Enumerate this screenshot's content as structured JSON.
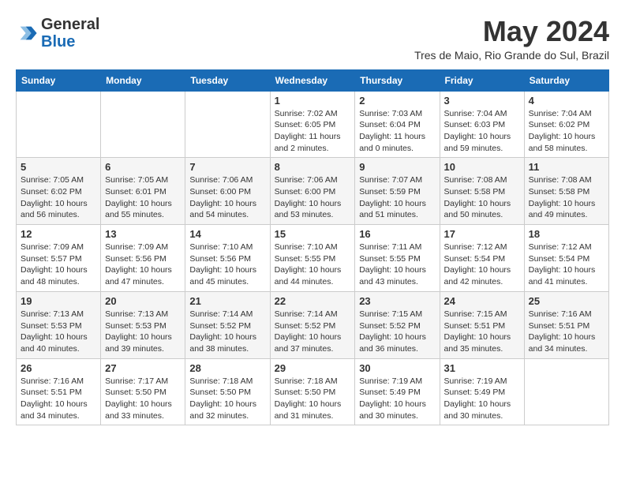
{
  "header": {
    "logo_general": "General",
    "logo_blue": "Blue",
    "month_title": "May 2024",
    "location": "Tres de Maio, Rio Grande do Sul, Brazil"
  },
  "calendar": {
    "days_of_week": [
      "Sunday",
      "Monday",
      "Tuesday",
      "Wednesday",
      "Thursday",
      "Friday",
      "Saturday"
    ],
    "weeks": [
      [
        {
          "day": "",
          "content": ""
        },
        {
          "day": "",
          "content": ""
        },
        {
          "day": "",
          "content": ""
        },
        {
          "day": "1",
          "content": "Sunrise: 7:02 AM\nSunset: 6:05 PM\nDaylight: 11 hours\nand 2 minutes."
        },
        {
          "day": "2",
          "content": "Sunrise: 7:03 AM\nSunset: 6:04 PM\nDaylight: 11 hours\nand 0 minutes."
        },
        {
          "day": "3",
          "content": "Sunrise: 7:04 AM\nSunset: 6:03 PM\nDaylight: 10 hours\nand 59 minutes."
        },
        {
          "day": "4",
          "content": "Sunrise: 7:04 AM\nSunset: 6:02 PM\nDaylight: 10 hours\nand 58 minutes."
        }
      ],
      [
        {
          "day": "5",
          "content": "Sunrise: 7:05 AM\nSunset: 6:02 PM\nDaylight: 10 hours\nand 56 minutes."
        },
        {
          "day": "6",
          "content": "Sunrise: 7:05 AM\nSunset: 6:01 PM\nDaylight: 10 hours\nand 55 minutes."
        },
        {
          "day": "7",
          "content": "Sunrise: 7:06 AM\nSunset: 6:00 PM\nDaylight: 10 hours\nand 54 minutes."
        },
        {
          "day": "8",
          "content": "Sunrise: 7:06 AM\nSunset: 6:00 PM\nDaylight: 10 hours\nand 53 minutes."
        },
        {
          "day": "9",
          "content": "Sunrise: 7:07 AM\nSunset: 5:59 PM\nDaylight: 10 hours\nand 51 minutes."
        },
        {
          "day": "10",
          "content": "Sunrise: 7:08 AM\nSunset: 5:58 PM\nDaylight: 10 hours\nand 50 minutes."
        },
        {
          "day": "11",
          "content": "Sunrise: 7:08 AM\nSunset: 5:58 PM\nDaylight: 10 hours\nand 49 minutes."
        }
      ],
      [
        {
          "day": "12",
          "content": "Sunrise: 7:09 AM\nSunset: 5:57 PM\nDaylight: 10 hours\nand 48 minutes."
        },
        {
          "day": "13",
          "content": "Sunrise: 7:09 AM\nSunset: 5:56 PM\nDaylight: 10 hours\nand 47 minutes."
        },
        {
          "day": "14",
          "content": "Sunrise: 7:10 AM\nSunset: 5:56 PM\nDaylight: 10 hours\nand 45 minutes."
        },
        {
          "day": "15",
          "content": "Sunrise: 7:10 AM\nSunset: 5:55 PM\nDaylight: 10 hours\nand 44 minutes."
        },
        {
          "day": "16",
          "content": "Sunrise: 7:11 AM\nSunset: 5:55 PM\nDaylight: 10 hours\nand 43 minutes."
        },
        {
          "day": "17",
          "content": "Sunrise: 7:12 AM\nSunset: 5:54 PM\nDaylight: 10 hours\nand 42 minutes."
        },
        {
          "day": "18",
          "content": "Sunrise: 7:12 AM\nSunset: 5:54 PM\nDaylight: 10 hours\nand 41 minutes."
        }
      ],
      [
        {
          "day": "19",
          "content": "Sunrise: 7:13 AM\nSunset: 5:53 PM\nDaylight: 10 hours\nand 40 minutes."
        },
        {
          "day": "20",
          "content": "Sunrise: 7:13 AM\nSunset: 5:53 PM\nDaylight: 10 hours\nand 39 minutes."
        },
        {
          "day": "21",
          "content": "Sunrise: 7:14 AM\nSunset: 5:52 PM\nDaylight: 10 hours\nand 38 minutes."
        },
        {
          "day": "22",
          "content": "Sunrise: 7:14 AM\nSunset: 5:52 PM\nDaylight: 10 hours\nand 37 minutes."
        },
        {
          "day": "23",
          "content": "Sunrise: 7:15 AM\nSunset: 5:52 PM\nDaylight: 10 hours\nand 36 minutes."
        },
        {
          "day": "24",
          "content": "Sunrise: 7:15 AM\nSunset: 5:51 PM\nDaylight: 10 hours\nand 35 minutes."
        },
        {
          "day": "25",
          "content": "Sunrise: 7:16 AM\nSunset: 5:51 PM\nDaylight: 10 hours\nand 34 minutes."
        }
      ],
      [
        {
          "day": "26",
          "content": "Sunrise: 7:16 AM\nSunset: 5:51 PM\nDaylight: 10 hours\nand 34 minutes."
        },
        {
          "day": "27",
          "content": "Sunrise: 7:17 AM\nSunset: 5:50 PM\nDaylight: 10 hours\nand 33 minutes."
        },
        {
          "day": "28",
          "content": "Sunrise: 7:18 AM\nSunset: 5:50 PM\nDaylight: 10 hours\nand 32 minutes."
        },
        {
          "day": "29",
          "content": "Sunrise: 7:18 AM\nSunset: 5:50 PM\nDaylight: 10 hours\nand 31 minutes."
        },
        {
          "day": "30",
          "content": "Sunrise: 7:19 AM\nSunset: 5:49 PM\nDaylight: 10 hours\nand 30 minutes."
        },
        {
          "day": "31",
          "content": "Sunrise: 7:19 AM\nSunset: 5:49 PM\nDaylight: 10 hours\nand 30 minutes."
        },
        {
          "day": "",
          "content": ""
        }
      ]
    ]
  }
}
